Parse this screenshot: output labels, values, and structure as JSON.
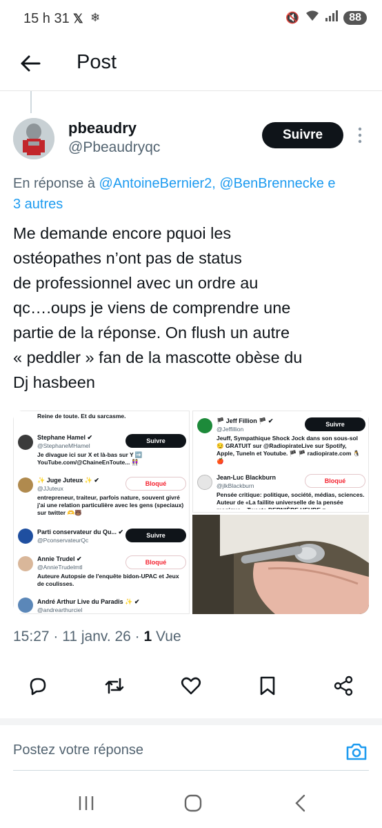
{
  "status_bar": {
    "time": "15 h 31",
    "battery": "88"
  },
  "header": {
    "title": "Post"
  },
  "post": {
    "author_name": "pbeaudry",
    "author_handle": "@Pbeaudryqc",
    "follow_label": "Suivre",
    "reply_prefix": "En réponse à ",
    "reply_mentions": "@AntoineBernier2, @BenBrennecke e",
    "reply_more": "3 autres",
    "text": "Me demande encore pquoi les\nostéopathes n’ont pas de status\nde professionnel avec un ordre au\nqc….oups je viens de comprendre une\npartie de la réponse. On flush un autre\n« peddler » fan de la mascotte obèse du\nDj hasbeen",
    "timestamp": "15:27 · 11 janv. 26 · ",
    "views_count": "1",
    "views_label": " Vue"
  },
  "media": {
    "left_panel": {
      "top_text": "Reine de toute. Et du sarcasme.",
      "rows": [
        {
          "name": "Stephane Hamel ✔",
          "handle": "@StephaneMHamel",
          "bio": "Je divague ici sur X et là-bas sur Y ➡️ YouTube.com/@ChaineEnToute... 👭",
          "button": "Suivre"
        },
        {
          "name": "✨ Juge Juteux ✨ ✔",
          "handle": "@JJuteux",
          "bio": "entrepreneur, traiteur, parfois nature, souvent givré j'ai une relation particulière avec les gens (speciaux) sur twitter 🫶🐻",
          "button": "Bloqué"
        },
        {
          "name": "Parti conservateur du Qu... ✔",
          "handle": "@PconservateurQc",
          "bio": "",
          "button": "Suivre"
        },
        {
          "name": "Annie Trudel ✔",
          "handle": "@AnnieTrudelmtl",
          "bio": "Auteure Autopsie de l'enquête bidon-UPAC et Jeux de coulisses.",
          "button": "Bloqué"
        },
        {
          "name": "André Arthur Live du Paradis ✨ ✔",
          "handle": "@andrearthurciel",
          "bio": "",
          "button": ""
        }
      ]
    },
    "right_panel": {
      "rows": [
        {
          "name": "🏴 Jeff Fillion 🏴 ✔",
          "handle": "@Jeffillion",
          "bio": "Jeuff, Sympathique Shock Jock dans son sous-sol 😏 GRATUIT sur @RadiopirateLive sur Spotify, Apple, TuneIn et Youtube. 🏴 🏴 radiopirate.com 🐧🍎",
          "button": "Suivre"
        },
        {
          "name": "Jean-Luc Blackburn",
          "handle": "@jlkBlackburn",
          "bio": "Pensée critique: politique, société, médias, sciences. Auteur de «La faillite universelle de la pensée magique». Tweets DERNIÈRE HEURE =",
          "button": "Bloqué"
        }
      ]
    }
  },
  "compose": {
    "placeholder": "Postez votre réponse"
  },
  "icons": {
    "back": "arrow-left-icon",
    "kebab": "more-vertical-icon",
    "reply": "reply-icon",
    "repost": "repost-icon",
    "like": "heart-icon",
    "bookmark": "bookmark-icon",
    "share": "share-icon",
    "camera": "camera-icon"
  },
  "colors": {
    "link": "#1d9bf0",
    "follow_bg": "#0f1419",
    "blocked": "#f4212e"
  }
}
